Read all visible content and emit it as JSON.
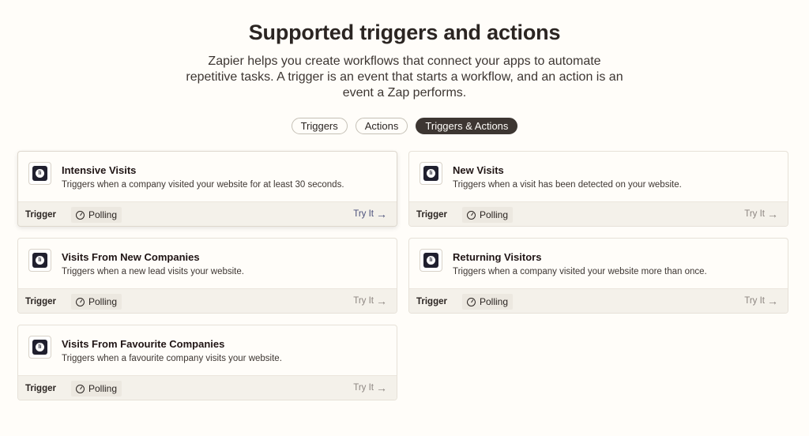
{
  "header": {
    "title": "Supported triggers and actions",
    "subtitle": "Zapier helps you create workflows that connect your apps to automate repetitive tasks. A trigger is an event that starts a workflow, and an action is an event a Zap performs."
  },
  "tabs": [
    {
      "label": "Triggers",
      "active": false
    },
    {
      "label": "Actions",
      "active": false
    },
    {
      "label": "Triggers & Actions",
      "active": true
    }
  ],
  "cards": [
    {
      "title": "Intensive Visits",
      "description": "Triggers when a company visited your website for at least 30 seconds.",
      "type": "Trigger",
      "mode": "Polling",
      "cta": "Try It"
    },
    {
      "title": "New Visits",
      "description": "Triggers when a visit has been detected on your website.",
      "type": "Trigger",
      "mode": "Polling",
      "cta": "Try It"
    },
    {
      "title": "Visits From New Companies",
      "description": "Triggers when a new lead visits your website.",
      "type": "Trigger",
      "mode": "Polling",
      "cta": "Try It"
    },
    {
      "title": "Returning Visitors",
      "description": "Triggers when a company visited your website more than once.",
      "type": "Trigger",
      "mode": "Polling",
      "cta": "Try It"
    },
    {
      "title": "Visits From Favourite Companies",
      "description": "Triggers when a favourite company visits your website.",
      "type": "Trigger",
      "mode": "Polling",
      "cta": "Try It"
    }
  ],
  "icons": {
    "app": "leadinfo-app-icon",
    "polling": "clock-icon",
    "cta": "arrow-right-icon"
  },
  "colors": {
    "background": "#fffdf9",
    "active_tab": "#3d3632",
    "card_footer": "#f4f1ea",
    "cta_focused": "#4a4f7a"
  }
}
